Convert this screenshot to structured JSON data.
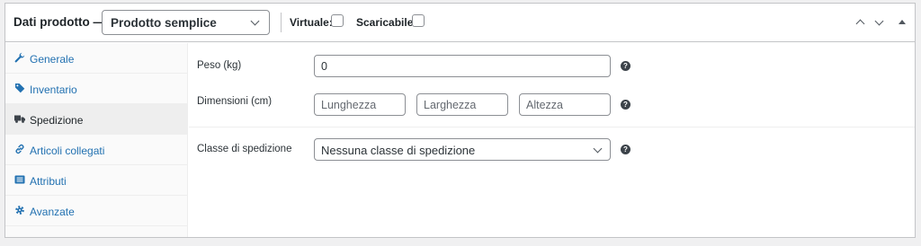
{
  "header": {
    "title": "Dati prodotto —",
    "product_type": "Prodotto semplice",
    "virtual_label": "Virtuale:",
    "downloadable_label": "Scaricabile:"
  },
  "tabs": [
    {
      "label": "Generale",
      "icon": "wrench-icon"
    },
    {
      "label": "Inventario",
      "icon": "tag-icon"
    },
    {
      "label": "Spedizione",
      "icon": "truck-icon",
      "active": true
    },
    {
      "label": "Articoli collegati",
      "icon": "link-icon"
    },
    {
      "label": "Attributi",
      "icon": "list-icon"
    },
    {
      "label": "Avanzate",
      "icon": "gear-icon"
    }
  ],
  "shipping": {
    "weight_label": "Peso (kg)",
    "weight_value": "0",
    "dimensions_label": "Dimensioni (cm)",
    "length_placeholder": "Lunghezza",
    "width_placeholder": "Larghezza",
    "height_placeholder": "Altezza",
    "class_label": "Classe di spedizione",
    "class_value": "Nessuna classe di spedizione",
    "help_glyph": "?"
  },
  "colors": {
    "link": "#2271b1",
    "text": "#1d2327",
    "border": "#c3c4c7",
    "background": "#f0f0f1"
  }
}
